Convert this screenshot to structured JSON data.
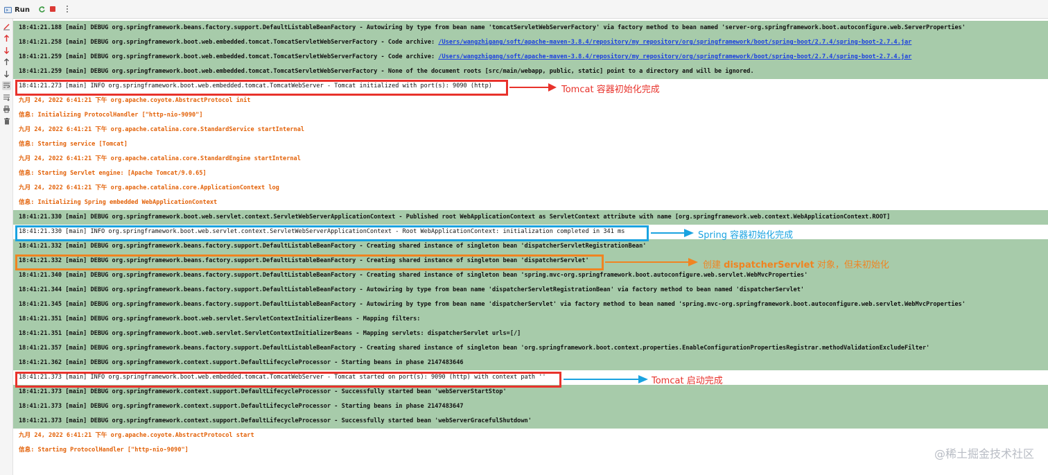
{
  "toolbar": {
    "run_label": "Run",
    "icons": [
      "run-icon",
      "rerun-icon",
      "stop-icon",
      "more-icon"
    ]
  },
  "sidebar": {
    "icons": [
      "clear-icon",
      "up-red-icon",
      "down-red-icon",
      "up-icon",
      "down-icon",
      "soft-wrap-icon",
      "scroll-to-end-icon",
      "print-icon",
      "trash-icon"
    ]
  },
  "colors": {
    "debug_bg": "#a7cbaa",
    "error_text": "#e36209",
    "red": "#e8322b",
    "blue": "#1aa3e0",
    "orange": "#f08421"
  },
  "lines": [
    {
      "kind": "debug",
      "text": "18:41:21.188 [main] DEBUG org.springframework.beans.factory.support.DefaultListableBeanFactory - Autowiring by type from bean name 'tomcatServletWebServerFactory' via factory method to bean named 'server-org.springframework.boot.autoconfigure.web.ServerProperties'"
    },
    {
      "kind": "debug",
      "text": "18:41:21.258 [main] DEBUG org.springframework.boot.web.embedded.tomcat.TomcatServletWebServerFactory - Code archive: ",
      "link": "/Users/wangzhigang/soft/apache-maven-3.8.4/repository/my_repository/org/springframework/boot/spring-boot/2.7.4/spring-boot-2.7.4.jar"
    },
    {
      "kind": "debug",
      "text": "18:41:21.259 [main] DEBUG org.springframework.boot.web.embedded.tomcat.TomcatServletWebServerFactory - Code archive: ",
      "link": "/Users/wangzhigang/soft/apache-maven-3.8.4/repository/my_repository/org/springframework/boot/spring-boot/2.7.4/spring-boot-2.7.4.jar"
    },
    {
      "kind": "debug",
      "text": "18:41:21.259 [main] DEBUG org.springframework.boot.web.embedded.tomcat.TomcatServletWebServerFactory - None of the document roots [src/main/webapp, public, static] point to a directory and will be ignored."
    },
    {
      "kind": "info",
      "text": "18:41:21.273 [main] INFO org.springframework.boot.web.embedded.tomcat.TomcatWebServer - Tomcat initialized with port(s): 9090 (http)"
    },
    {
      "kind": "err",
      "text": "九月 24, 2022 6:41:21 下午 org.apache.coyote.AbstractProtocol init"
    },
    {
      "kind": "err",
      "text": "信息: Initializing ProtocolHandler [\"http-nio-9090\"]"
    },
    {
      "kind": "err",
      "text": "九月 24, 2022 6:41:21 下午 org.apache.catalina.core.StandardService startInternal"
    },
    {
      "kind": "err",
      "text": "信息: Starting service [Tomcat]"
    },
    {
      "kind": "err",
      "text": "九月 24, 2022 6:41:21 下午 org.apache.catalina.core.StandardEngine startInternal"
    },
    {
      "kind": "err",
      "text": "信息: Starting Servlet engine: [Apache Tomcat/9.0.65]"
    },
    {
      "kind": "err",
      "text": "九月 24, 2022 6:41:21 下午 org.apache.catalina.core.ApplicationContext log"
    },
    {
      "kind": "err",
      "text": "信息: Initializing Spring embedded WebApplicationContext"
    },
    {
      "kind": "debug",
      "text": "18:41:21.330 [main] DEBUG org.springframework.boot.web.servlet.context.ServletWebServerApplicationContext - Published root WebApplicationContext as ServletContext attribute with name [org.springframework.web.context.WebApplicationContext.ROOT]"
    },
    {
      "kind": "info",
      "text": "18:41:21.330 [main] INFO org.springframework.boot.web.servlet.context.ServletWebServerApplicationContext - Root WebApplicationContext: initialization completed in 341 ms"
    },
    {
      "kind": "debug",
      "text": "18:41:21.332 [main] DEBUG org.springframework.beans.factory.support.DefaultListableBeanFactory - Creating shared instance of singleton bean 'dispatcherServletRegistrationBean'"
    },
    {
      "kind": "debug",
      "text": "18:41:21.332 [main] DEBUG org.springframework.beans.factory.support.DefaultListableBeanFactory - Creating shared instance of singleton bean 'dispatcherServlet'"
    },
    {
      "kind": "debug",
      "text": "18:41:21.340 [main] DEBUG org.springframework.beans.factory.support.DefaultListableBeanFactory - Creating shared instance of singleton bean 'spring.mvc-org.springframework.boot.autoconfigure.web.servlet.WebMvcProperties'"
    },
    {
      "kind": "debug",
      "text": "18:41:21.344 [main] DEBUG org.springframework.beans.factory.support.DefaultListableBeanFactory - Autowiring by type from bean name 'dispatcherServletRegistrationBean' via factory method to bean named 'dispatcherServlet'"
    },
    {
      "kind": "debug",
      "text": "18:41:21.345 [main] DEBUG org.springframework.beans.factory.support.DefaultListableBeanFactory - Autowiring by type from bean name 'dispatcherServlet' via factory method to bean named 'spring.mvc-org.springframework.boot.autoconfigure.web.servlet.WebMvcProperties'"
    },
    {
      "kind": "debug",
      "text": "18:41:21.351 [main] DEBUG org.springframework.boot.web.servlet.ServletContextInitializerBeans - Mapping filters:"
    },
    {
      "kind": "debug",
      "text": "18:41:21.351 [main] DEBUG org.springframework.boot.web.servlet.ServletContextInitializerBeans - Mapping servlets: dispatcherServlet urls=[/]"
    },
    {
      "kind": "debug",
      "text": "18:41:21.357 [main] DEBUG org.springframework.beans.factory.support.DefaultListableBeanFactory - Creating shared instance of singleton bean 'org.springframework.boot.context.properties.EnableConfigurationPropertiesRegistrar.methodValidationExcludeFilter'"
    },
    {
      "kind": "debug",
      "text": "18:41:21.362 [main] DEBUG org.springframework.context.support.DefaultLifecycleProcessor - Starting beans in phase 2147483646"
    },
    {
      "kind": "info",
      "text": "18:41:21.373 [main] INFO org.springframework.boot.web.embedded.tomcat.TomcatWebServer - Tomcat started on port(s): 9090 (http) with context path ''"
    },
    {
      "kind": "debug",
      "text": "18:41:21.373 [main] DEBUG org.springframework.context.support.DefaultLifecycleProcessor - Successfully started bean 'webServerStartStop'"
    },
    {
      "kind": "debug",
      "text": "18:41:21.373 [main] DEBUG org.springframework.context.support.DefaultLifecycleProcessor - Starting beans in phase 2147483647"
    },
    {
      "kind": "debug",
      "text": "18:41:21.373 [main] DEBUG org.springframework.context.support.DefaultLifecycleProcessor - Successfully started bean 'webServerGracefulShutdown'"
    },
    {
      "kind": "err",
      "text": "九月 24, 2022 6:41:21 下午 org.apache.coyote.AbstractProtocol start"
    },
    {
      "kind": "err",
      "text": "信息: Starting ProtocolHandler [\"http-nio-9090\"]"
    }
  ],
  "annotations": {
    "tomcat_init": "Tomcat 容器初始化完成",
    "spring_init": "Spring 容器初始化完成",
    "dispatcher_pre": "创建 ",
    "dispatcher_bold": "dispatcherServlet",
    "dispatcher_post": " 对象，但未初始化",
    "tomcat_started": "Tomcat 启动完成"
  },
  "watermark": "@稀土掘金技术社区"
}
